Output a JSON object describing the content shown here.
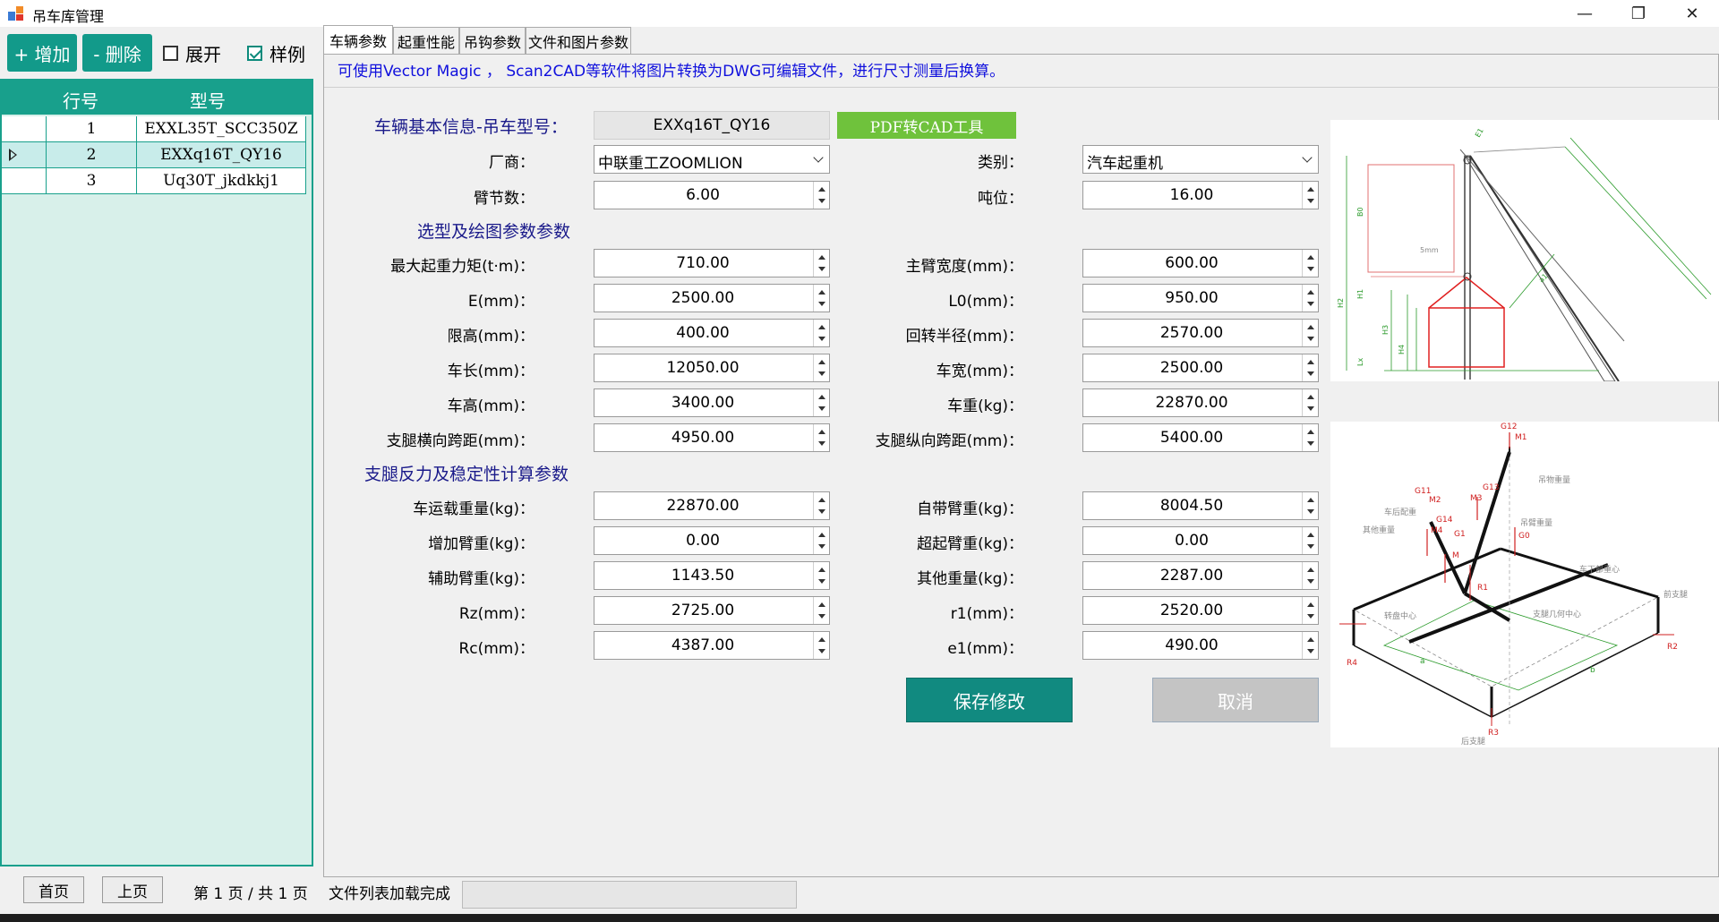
{
  "window": {
    "title": "吊车库管理",
    "minimize": "—",
    "restore": "❐",
    "close": "✕"
  },
  "toolbar": {
    "add_label": "+ 增加",
    "delete_label": "- 删除",
    "expand_label": "展开",
    "expand_checked": false,
    "sample_label": "样例",
    "sample_checked": true
  },
  "grid": {
    "columns": [
      "行号",
      "型号"
    ],
    "rows": [
      {
        "no": "1",
        "model": "EXXL35T_SCC350Z",
        "selected": false
      },
      {
        "no": "2",
        "model": "EXXq16T_QY16",
        "selected": true
      },
      {
        "no": "3",
        "model": "Uq30T_jkdkkj1",
        "selected": false
      }
    ]
  },
  "pager": {
    "first": "首页",
    "prev": "上页",
    "info": "第 1 页 / 共 1 页"
  },
  "tabs": [
    "车辆参数",
    "起重性能",
    "吊钩参数",
    "文件和图片参数"
  ],
  "hint": "可使用Vector Magic ， Scan2CAD等软件将图片转换为DWG可编辑文件，进行尺寸测量后换算。",
  "basic": {
    "heading": "车辆基本信息-吊车型号：",
    "model": "EXXq16T_QY16",
    "pdf_button": "PDF转CAD工具",
    "maker_label": "厂商：",
    "maker": "中联重工ZOOMLION",
    "category_label": "类别：",
    "category": "汽车起重机",
    "boom_sections_label": "臂节数：",
    "boom_sections": "6.00",
    "tonnage_label": "吨位：",
    "tonnage": "16.00"
  },
  "draw": {
    "heading": "选型及绘图参数参数",
    "left": [
      {
        "label": "最大起重力矩(t·m)：",
        "value": "710.00"
      },
      {
        "label": "E(mm)：",
        "value": "2500.00"
      },
      {
        "label": "限高(mm)：",
        "value": "400.00"
      },
      {
        "label": "车长(mm)：",
        "value": "12050.00"
      },
      {
        "label": "车高(mm)：",
        "value": "3400.00"
      },
      {
        "label": "支腿横向跨距(mm)：",
        "value": "4950.00"
      }
    ],
    "right": [
      {
        "label": "主臂宽度(mm)：",
        "value": "600.00"
      },
      {
        "label": "L0(mm)：",
        "value": "950.00"
      },
      {
        "label": "回转半径(mm)：",
        "value": "2570.00"
      },
      {
        "label": "车宽(mm)：",
        "value": "2500.00"
      },
      {
        "label": "车重(kg)：",
        "value": "22870.00"
      },
      {
        "label": "支腿纵向跨距(mm)：",
        "value": "5400.00"
      }
    ]
  },
  "stability": {
    "heading": "支腿反力及稳定性计算参数",
    "left": [
      {
        "label": "车运载重量(kg)：",
        "value": "22870.00"
      },
      {
        "label": "增加臂重(kg)：",
        "value": "0.00"
      },
      {
        "label": "辅助臂重(kg)：",
        "value": "1143.50"
      },
      {
        "label": "Rz(mm)：",
        "value": "2725.00"
      },
      {
        "label": "Rc(mm)：",
        "value": "4387.00"
      }
    ],
    "right": [
      {
        "label": "自带臂重(kg)：",
        "value": "8004.50"
      },
      {
        "label": "超起臂重(kg)：",
        "value": "0.00"
      },
      {
        "label": "其他重量(kg)：",
        "value": "2287.00"
      },
      {
        "label": "r1(mm)：",
        "value": "2520.00"
      },
      {
        "label": "e1(mm)：",
        "value": "490.00"
      }
    ]
  },
  "actions": {
    "save": "保存修改",
    "cancel": "取消"
  },
  "diagram_top": {
    "labels": [
      "B0",
      "H1",
      "H2",
      "H3",
      "H4",
      "Lx",
      "E1",
      "a1",
      "5mm"
    ]
  },
  "diagram_bottom": {
    "labels": [
      "G12",
      "M1",
      "吊物重量",
      "G11",
      "M2",
      "G13",
      "M3",
      "车后配重",
      "G14",
      "M4",
      "G1",
      "其他重量",
      "吊臂重量",
      "G0",
      "M",
      "车下部重心",
      "R1",
      "R2",
      "R3",
      "R4",
      "转盘中心",
      "支腿几何中心",
      "前支腿",
      "后支腿",
      "a",
      "b"
    ]
  },
  "status": {
    "text": "文件列表加载完成"
  },
  "colors": {
    "accent": "#18a08c",
    "save": "#118a80",
    "pdf": "#6fc23c",
    "section": "#1a1a8a",
    "hint": "#1010dd"
  }
}
